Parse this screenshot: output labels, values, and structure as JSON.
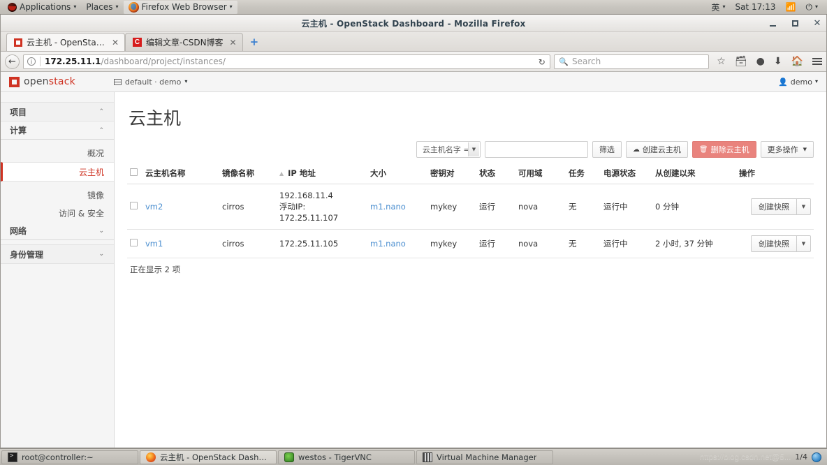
{
  "desktop": {
    "menus": [
      {
        "label": "Applications",
        "icon": "fedora-logo"
      },
      {
        "label": "Places",
        "icon": null
      },
      {
        "label": "Firefox Web Browser",
        "icon": "firefox-icon"
      }
    ],
    "tray": {
      "input_method": "英",
      "clock": "Sat 17:13",
      "wifi_icon": "wifi-icon",
      "power_icon": "power-icon"
    }
  },
  "browser": {
    "window_title": "云主机 - OpenStack Dashboard - Mozilla Firefox",
    "window_controls": {
      "minimize": "–",
      "maximize": "▫",
      "close": "✕"
    },
    "tabs": [
      {
        "title": "云主机 - OpenStack ...",
        "favicon": "openstack-favicon",
        "selected": true,
        "close": "✕"
      },
      {
        "title": "编辑文章-CSDN博客",
        "favicon": "csdn-favicon",
        "selected": false,
        "close": "✕"
      }
    ],
    "new_tab_label": "+",
    "url_host": "172.25.11.1",
    "url_path": "/dashboard/project/instances/",
    "reload_icon": "reload-icon",
    "search": {
      "placeholder": "Search",
      "icon": "search-icon"
    },
    "nav_icons": [
      "star-icon",
      "reader-icon",
      "pocket-icon",
      "download-icon",
      "home-icon",
      "menu-icon"
    ]
  },
  "openstack": {
    "brand_open": "open",
    "brand_stack": "stack",
    "context": "default · demo",
    "user": "demo",
    "sidebar": [
      {
        "label": "项目",
        "type": "group",
        "expanded": true,
        "chevron": "⌃"
      },
      {
        "label": "计算",
        "type": "subgroup",
        "expanded": true,
        "chevron": "⌃"
      },
      {
        "label": "概况",
        "type": "item",
        "active": false
      },
      {
        "label": "云主机",
        "type": "item",
        "active": true
      },
      {
        "label": "镜像",
        "type": "item",
        "active": false
      },
      {
        "label": "访问 & 安全",
        "type": "item",
        "active": false
      },
      {
        "label": "网络",
        "type": "subgroup",
        "expanded": false,
        "chevron": "⌄"
      },
      {
        "label": "身份管理",
        "type": "group",
        "expanded": false,
        "chevron": "⌄"
      }
    ],
    "page_title": "云主机",
    "toolbar": {
      "filter_field": "云主机名字 =",
      "filter_value": "",
      "filter_button": "筛选",
      "create_button": "创建云主机",
      "create_icon": "cloud-icon",
      "delete_button": "删除云主机",
      "delete_icon": "trash-icon",
      "more_button": "更多操作"
    },
    "table": {
      "columns": [
        "云主机名称",
        "镜像名称",
        "IP 地址",
        "大小",
        "密钥对",
        "状态",
        "可用域",
        "任务",
        "电源状态",
        "从创建以来",
        "操作"
      ],
      "sorted_column": "IP 地址",
      "sort_direction": "asc",
      "rows": [
        {
          "selected": false,
          "name": "vm2",
          "image": "cirros",
          "ip_lines": [
            "192.168.11.4",
            "浮动IP:",
            "172.25.11.107"
          ],
          "flavor": "m1.nano",
          "keypair": "mykey",
          "status": "运行",
          "zone": "nova",
          "task": "无",
          "power": "运行中",
          "uptime": "0 分钟",
          "action": "创建快照"
        },
        {
          "selected": false,
          "name": "vm1",
          "image": "cirros",
          "ip_lines": [
            "172.25.11.105"
          ],
          "flavor": "m1.nano",
          "keypair": "mykey",
          "status": "运行",
          "zone": "nova",
          "task": "无",
          "power": "运行中",
          "uptime": "2 小时, 37 分钟",
          "action": "创建快照"
        }
      ],
      "footer": "正在显示 2 项"
    }
  },
  "taskbar": {
    "items": [
      {
        "label": "root@controller:~",
        "icon": "terminal-icon",
        "focused": false
      },
      {
        "label": "云主机 - OpenStack Dashboard - ...",
        "icon": "firefox-icon",
        "focused": true
      },
      {
        "label": "westos - TigerVNC",
        "icon": "vnc-icon",
        "focused": false
      },
      {
        "label": "Virtual Machine Manager",
        "icon": "vmm-icon",
        "focused": false
      }
    ],
    "watermark": "https://blog.csdn.net@5...",
    "workspace": "1/4"
  }
}
